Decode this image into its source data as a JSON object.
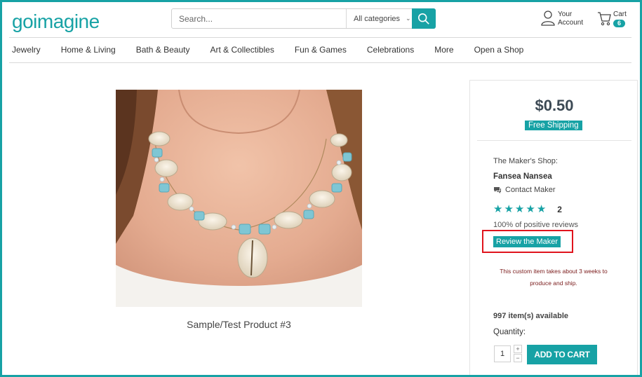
{
  "header": {
    "logo_text": "goimagine",
    "search_placeholder": "Search...",
    "category_select": "All categories",
    "account_line1": "Your",
    "account_line2": "Account",
    "cart_label": "Cart",
    "cart_count": "6"
  },
  "nav": {
    "items": [
      "Jewelry",
      "Home & Living",
      "Bath & Beauty",
      "Art & Collectibles",
      "Fun & Games",
      "Celebrations",
      "More",
      "Open a Shop"
    ]
  },
  "product": {
    "title": "Sample/Test Product #3",
    "price": "$0.50",
    "shipping_badge": "Free Shipping"
  },
  "maker": {
    "shop_label": "The Maker's Shop:",
    "name": "Fansea Nansea",
    "contact_label": "Contact Maker",
    "rating_stars": 5,
    "review_count": "2",
    "positive_reviews": "100% of positive reviews",
    "review_button": "Review the Maker"
  },
  "purchase": {
    "custom_note_line1": "This custom item takes about 3 weeks to",
    "custom_note_line2": "produce and ship.",
    "availability": "997 item(s) available",
    "quantity_label": "Quantity:",
    "quantity_value": "1",
    "increment": "+",
    "decrement": "−",
    "add_to_cart": "ADD TO CART"
  },
  "colors": {
    "accent": "#17a2a5",
    "highlight": "#e0141d"
  }
}
